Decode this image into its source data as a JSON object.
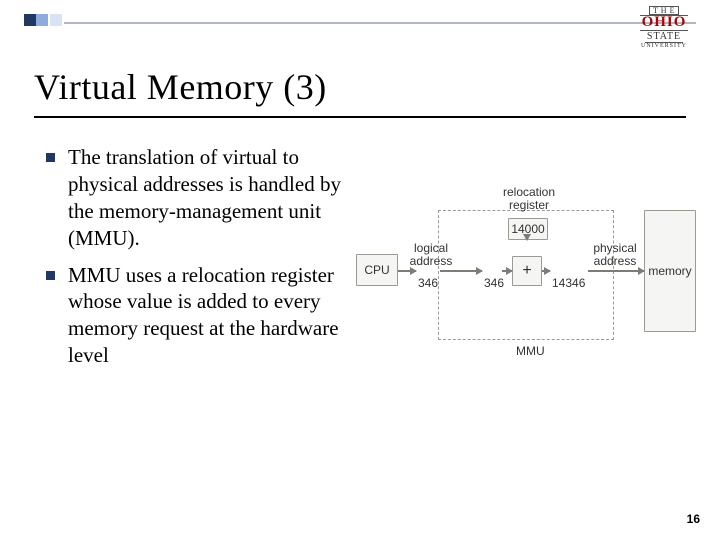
{
  "logo": {
    "the": "T H E",
    "ohio": "OHIO",
    "state": "STATE",
    "univ": "UNIVERSITY"
  },
  "title": "Virtual Memory (3)",
  "bullets": [
    "The translation of virtual to physical addresses is handled by the memory-management unit (MMU).",
    "MMU uses a relocation register whose value is added to every memory request at the hardware level"
  ],
  "diagram": {
    "cpu": "CPU",
    "plus": "+",
    "reloc_label": "relocation register",
    "reloc_value": "14000",
    "logical_label": "logical address",
    "logical_value": "346",
    "physical_label": "physical address",
    "physical_value": "14346",
    "memory": "memory",
    "mmu": "MMU"
  },
  "page_number": "16"
}
